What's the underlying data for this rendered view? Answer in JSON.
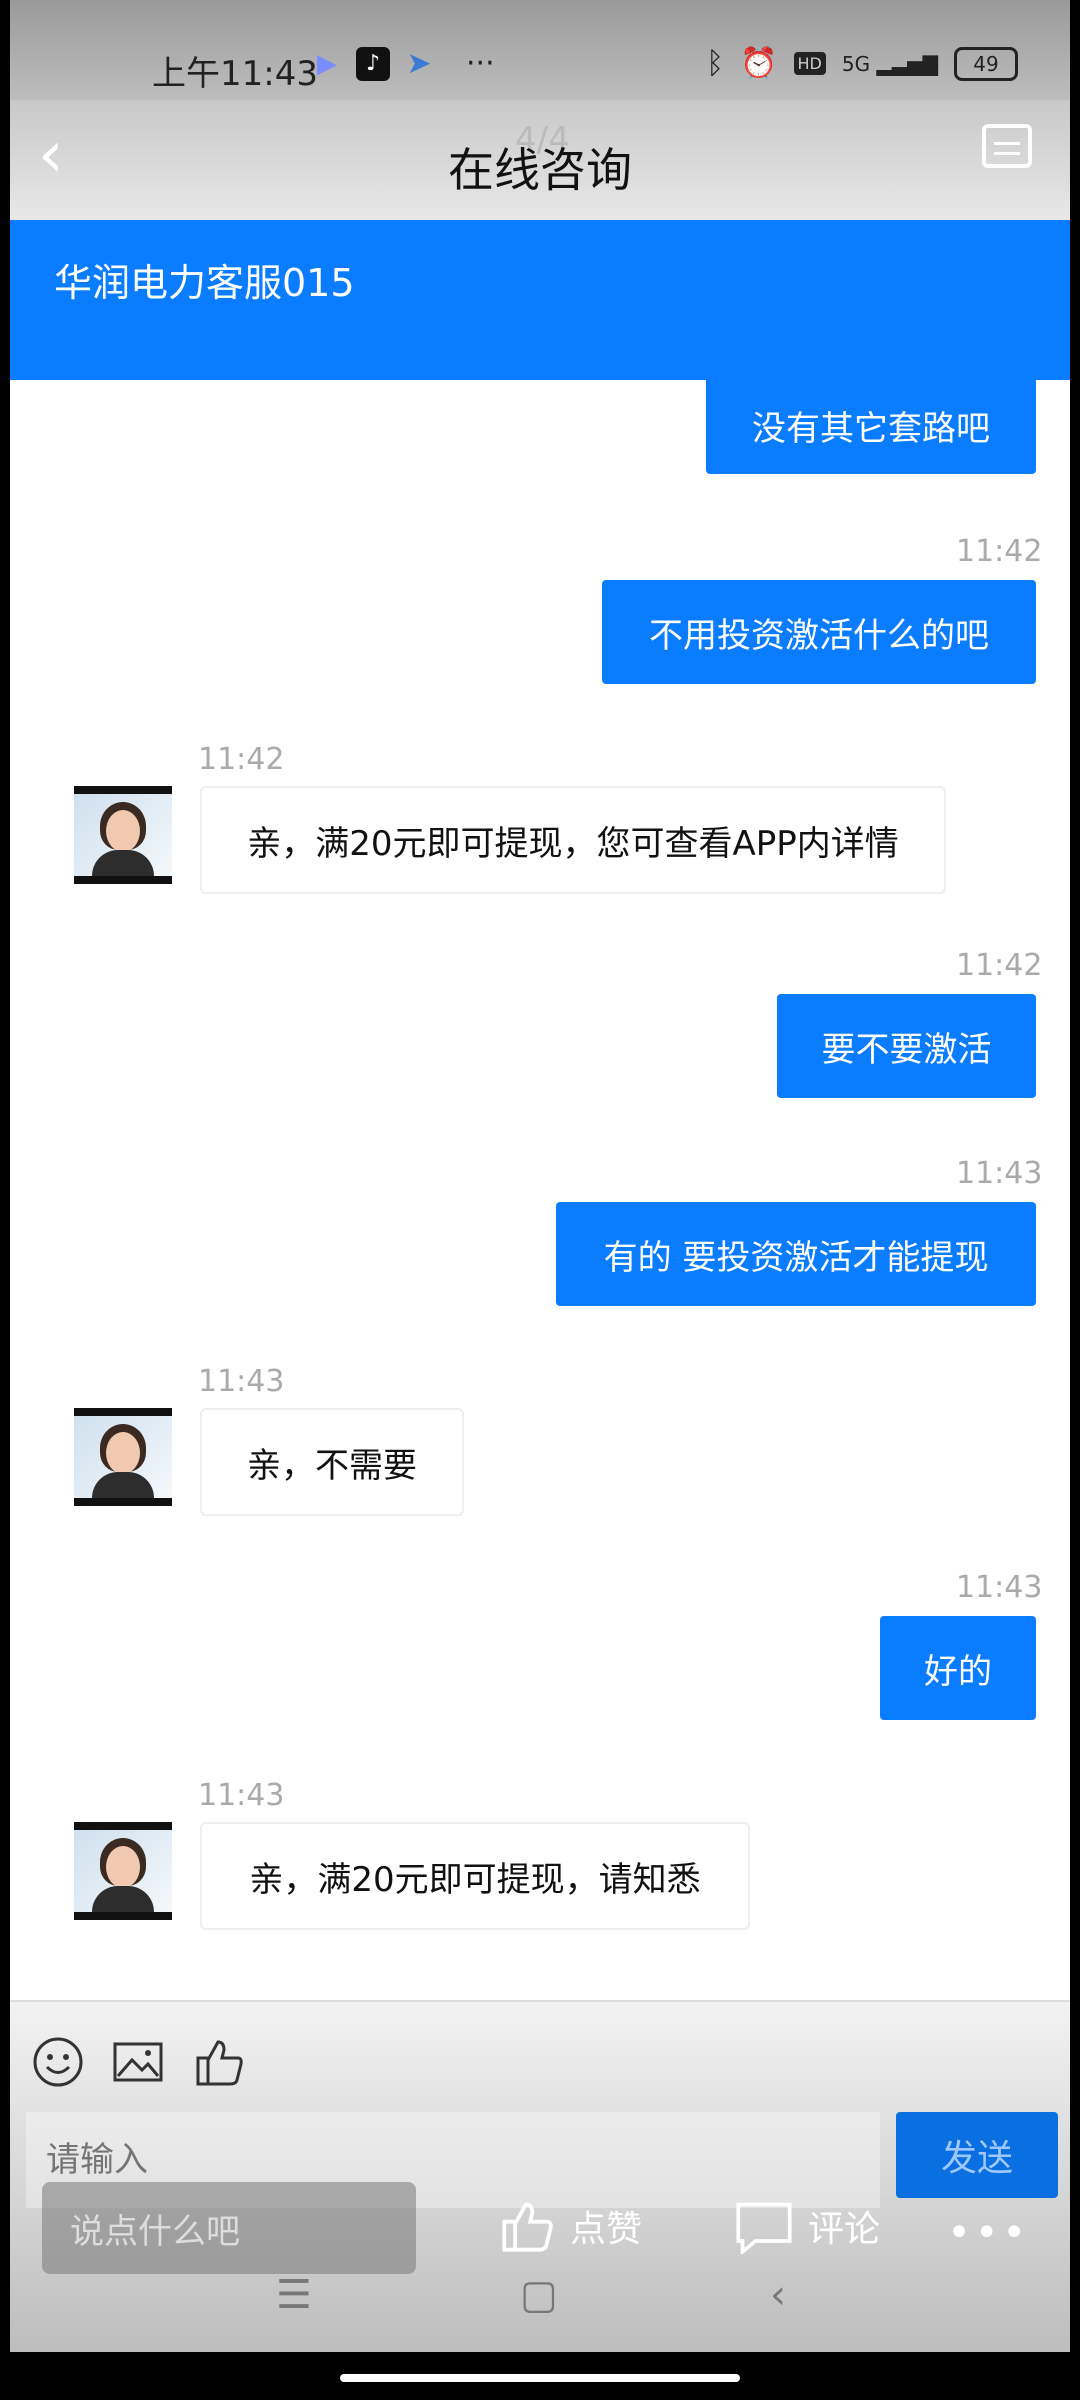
{
  "status_bar": {
    "time": "上午11:43",
    "more_indicator": "···",
    "signal": "5G",
    "hd": "HD",
    "battery": "49"
  },
  "header": {
    "title": "在线咨询",
    "page_counter": "4/4"
  },
  "agent": {
    "name": "华润电力客服015"
  },
  "messages": [
    {
      "from": "me",
      "time": "",
      "text": "没有其它套路吧"
    },
    {
      "from": "me",
      "time": "11:42",
      "text": "不用投资激活什么的吧"
    },
    {
      "from": "agent",
      "time": "11:42",
      "text": "亲，满20元即可提现，您可查看APP内详情"
    },
    {
      "from": "me",
      "time": "11:42",
      "text": "要不要激活"
    },
    {
      "from": "me",
      "time": "11:43",
      "text": "有的 要投资激活才能提现"
    },
    {
      "from": "agent",
      "time": "11:43",
      "text": "亲，不需要"
    },
    {
      "from": "me",
      "time": "11:43",
      "text": "好的"
    },
    {
      "from": "agent",
      "time": "11:43",
      "text": "亲，满20元即可提现，请知悉"
    }
  ],
  "composer": {
    "placeholder": "请输入",
    "send_label": "发送"
  },
  "overlay": {
    "comment_placeholder": "说点什么吧",
    "like_label": "点赞",
    "comment_label": "评论",
    "more": "•••"
  },
  "colors": {
    "accent": "#0a7cff",
    "send_button": "#0a6fe0"
  }
}
